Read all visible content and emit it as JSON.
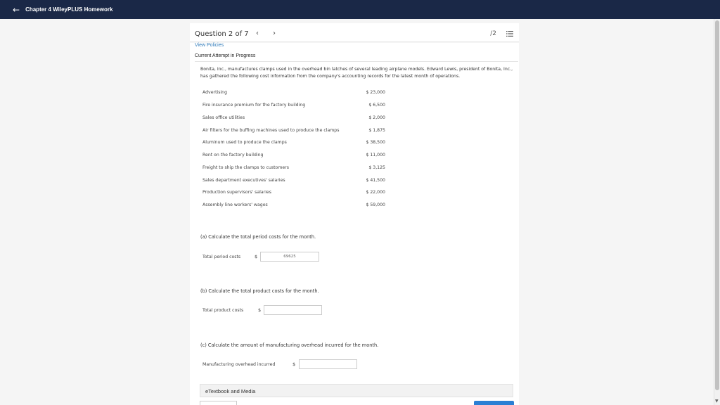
{
  "header": {
    "back_icon": "arrow-left-icon",
    "title": "Chapter 4 WileyPLUS Homework"
  },
  "question_nav": {
    "label": "Question 2 of 7",
    "prev": "‹",
    "next": "›",
    "score": "/2",
    "list_icon": "list-icon"
  },
  "policies": {
    "link": "View Policies",
    "status": "Current Attempt in Progress"
  },
  "problem": {
    "intro": "Bonita, Inc., manufactures clamps used in the overhead bin latches of several leading airplane models. Edward Lewis, president of Bonita, Inc., has gathered the following cost information from the company's accounting records for the latest month of operations.",
    "costs": [
      {
        "label": "Advertising",
        "amount": "$ 23,000"
      },
      {
        "label": "Fire insurance premium for the factory building",
        "amount": "$ 6,500"
      },
      {
        "label": "Sales office utilities",
        "amount": "$ 2,000"
      },
      {
        "label": "Air filters for the buffing machines used to produce the clamps",
        "amount": "$ 1,875"
      },
      {
        "label": "Aluminum used to produce the clamps",
        "amount": "$ 38,500"
      },
      {
        "label": "Rent on the factory building",
        "amount": "$ 11,000"
      },
      {
        "label": "Freight to ship the clamps to customers",
        "amount": "$ 3,125"
      },
      {
        "label": "Sales department executives' salaries",
        "amount": "$ 41,500"
      },
      {
        "label": "Production supervisors' salaries",
        "amount": "$ 22,000"
      },
      {
        "label": "Assembly line workers' wages",
        "amount": "$ 59,000"
      }
    ]
  },
  "parts": {
    "a": {
      "prompt": "(a) Calculate the total period costs for the month.",
      "label": "Total period costs",
      "currency": "$",
      "value": "69625"
    },
    "b": {
      "prompt": "(b) Calculate the total product costs for the month.",
      "label": "Total product costs",
      "currency": "$",
      "value": ""
    },
    "c": {
      "prompt": "(c) Calculate the amount of manufacturing overhead incurred for the month.",
      "label": "Manufacturing overhead incurred",
      "currency": "$",
      "value": ""
    }
  },
  "resources": {
    "etextbook": "eTextbook and Media"
  },
  "colors": {
    "topbar": "#1a2847",
    "link": "#2f7ab9",
    "primary_button": "#2a7fd4"
  }
}
